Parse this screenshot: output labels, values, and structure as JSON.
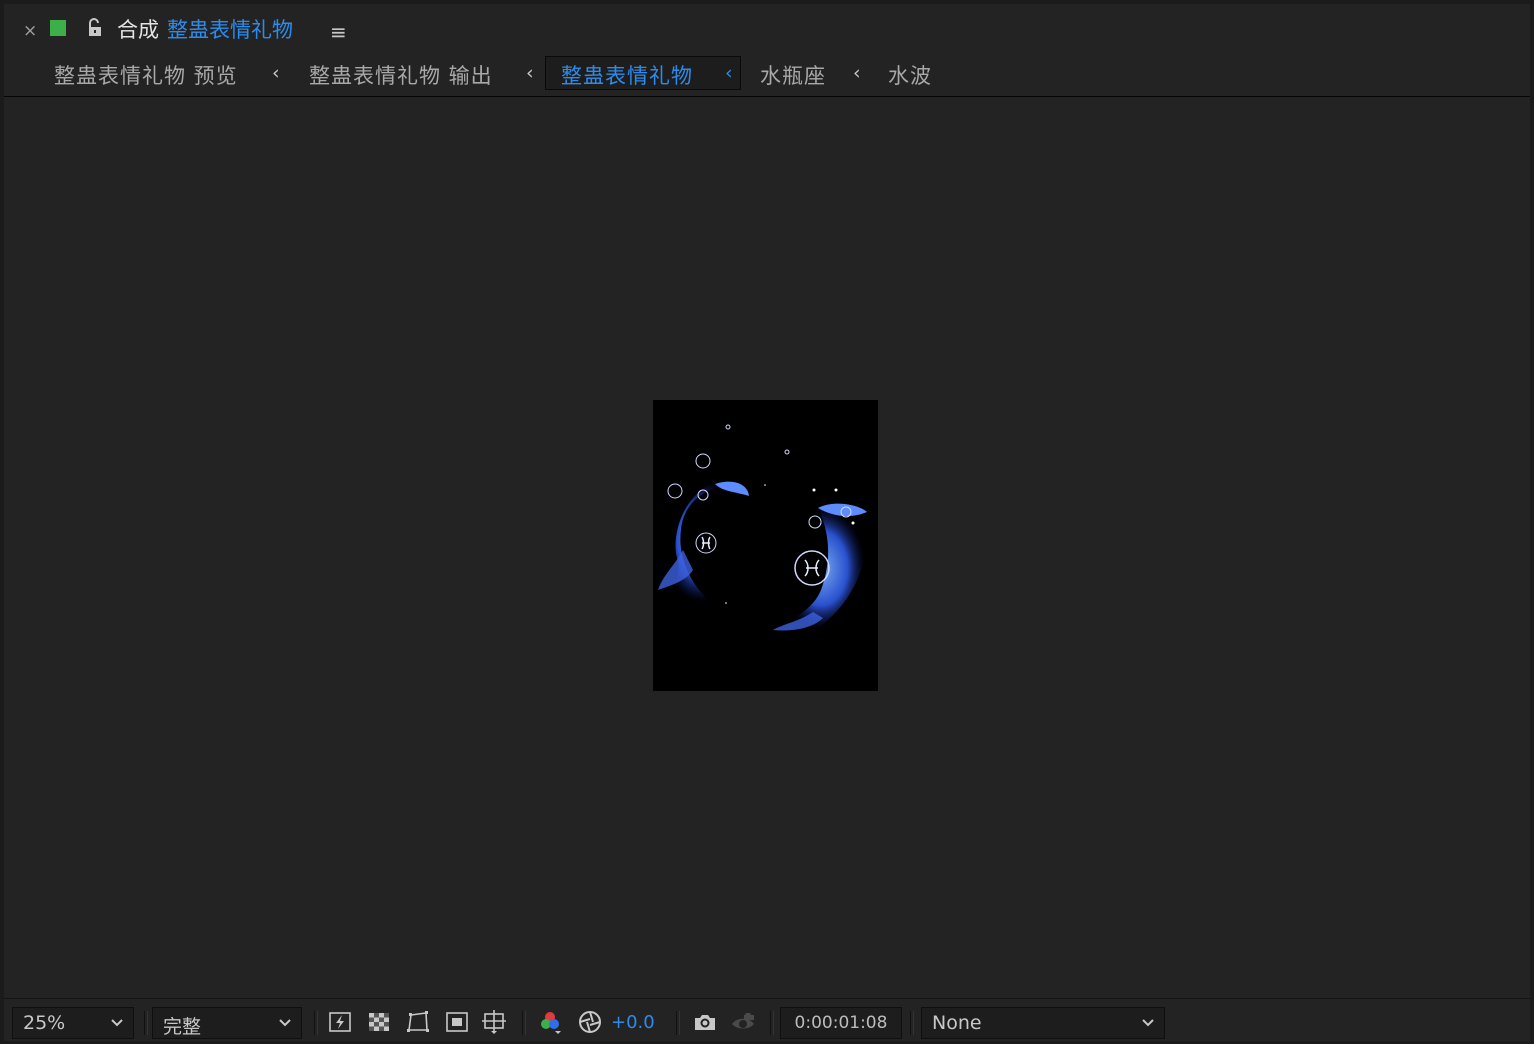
{
  "panel": {
    "close_glyph": "×",
    "label_color": "#3cae4a",
    "title_prefix": "合成",
    "composition_name": "整蛊表情礼物",
    "menu_glyph": "≡"
  },
  "breadcrumbs": [
    {
      "label": "整蛊表情礼物 预览"
    },
    {
      "label": "整蛊表情礼物 输出"
    },
    {
      "label": "整蛊表情礼物",
      "active": true
    },
    {
      "label": "水瓶座"
    },
    {
      "label": "水波"
    }
  ],
  "breadcrumb_separator": "‹",
  "toolbar": {
    "zoom": "25%",
    "resolution": "完整",
    "exposure": "+0.0",
    "timecode": "0:00:01:08",
    "view_option": "None",
    "icons": [
      "fast-previews-icon",
      "transparency-grid-icon",
      "mask-path-icon",
      "region-of-interest-icon",
      "guides-icon",
      "color-channels-icon",
      "reset-exposure-icon",
      "snapshot-icon",
      "show-snapshot-icon"
    ]
  },
  "colors": {
    "accent": "#2d8ceb",
    "panel_bg": "#232323",
    "frame_bg": "#000000"
  }
}
